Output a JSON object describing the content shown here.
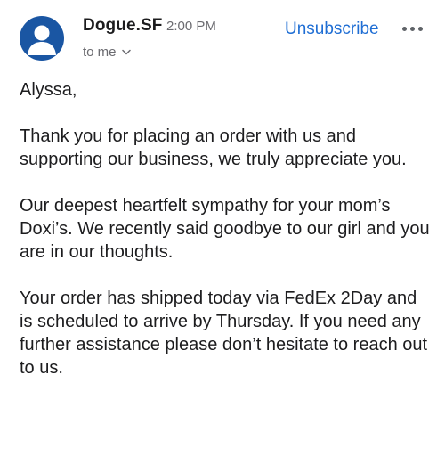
{
  "header": {
    "sender": "Dogue.SF",
    "time": "2:00 PM",
    "unsubscribe_label": "Unsubscribe",
    "to_label": "to me",
    "avatar_icon": "person-icon",
    "more_icon": "more-horizontal-icon",
    "chevron_icon": "chevron-down-icon"
  },
  "colors": {
    "avatar_bg": "#1a56a3",
    "link": "#1f6ed4",
    "muted": "#6b6b70"
  },
  "message": {
    "greeting": "Alyssa,",
    "paragraphs": [
      "Thank you for placing an order with us and supporting our business, we truly appreciate you.",
      "Our deepest heartfelt sympathy for your mom’s Doxi’s. We recently said goodbye to our girl and you are in our thoughts.",
      "Your order has shipped today via FedEx 2Day and is scheduled to arrive by Thursday. If you need any further assistance please don’t hesitate to reach out to us."
    ]
  }
}
